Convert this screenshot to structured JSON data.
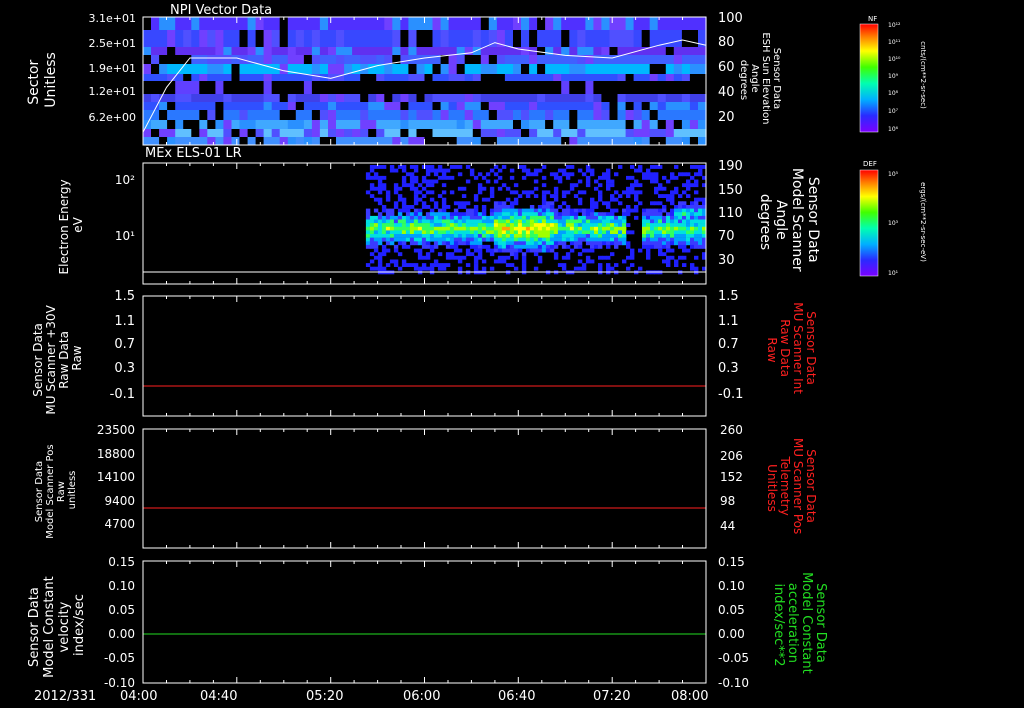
{
  "panels": {
    "p1": {
      "title": "NPI Vector Data",
      "left_label": [
        "Sector",
        "Unitless"
      ],
      "left_ticks": [
        "3.1e+01",
        "2.5e+01",
        "1.9e+01",
        "1.2e+01",
        "6.2e+00"
      ],
      "right_ticks": [
        "100",
        "80",
        "60",
        "40",
        "20"
      ],
      "right_label": [
        "Sensor Data",
        "ESH Sun Elevation",
        "Angle",
        "degrees"
      ],
      "colorbar": {
        "title": "NF",
        "ticks": [
          "10¹²",
          "10¹¹",
          "10¹⁰",
          "10⁹",
          "10⁸",
          "10⁷",
          "10⁶"
        ],
        "units": "cnts/(cm**2-sr-sec)"
      }
    },
    "p2": {
      "title": "MEx ELS-01 LR",
      "left_label": [
        "Electron Energy",
        "eV"
      ],
      "left_ticks": [
        "10²",
        "10¹"
      ],
      "right_ticks": [
        "190",
        "150",
        "110",
        "70",
        "30"
      ],
      "right_label": [
        "Sensor Data",
        "Model Scanner",
        "Angle",
        "degrees"
      ],
      "colorbar": {
        "title": "DEF",
        "ticks": [
          "10⁵",
          "10³",
          "10¹"
        ],
        "units": "ergs/(cm**2-sr-sec-eV)"
      }
    },
    "p3": {
      "left_label": [
        "Sensor Data",
        "MU Scanner +30V",
        "Raw Data",
        "Raw"
      ],
      "left_ticks": [
        "1.5",
        "1.1",
        "0.7",
        "0.3",
        "-0.1"
      ],
      "right_ticks": [
        "1.5",
        "1.1",
        "0.7",
        "0.3",
        "-0.1"
      ],
      "right_label": [
        "Sensor Data",
        "MU Scanner Int",
        "Raw Data",
        "Raw"
      ]
    },
    "p4": {
      "left_label": [
        "Sensor Data",
        "Model Scanner Pos",
        "Raw",
        "unitless"
      ],
      "left_ticks": [
        "23500",
        "18800",
        "14100",
        "9400",
        "4700"
      ],
      "right_ticks": [
        "260",
        "206",
        "152",
        "98",
        "44"
      ],
      "right_label": [
        "Sensor Data",
        "MU Scanner Pos",
        "Telemetry",
        "Unitless"
      ]
    },
    "p5": {
      "left_label": [
        "Sensor Data",
        "Model Constant",
        "velocity",
        "index/sec"
      ],
      "left_ticks": [
        "0.15",
        "0.10",
        "0.05",
        "0.00",
        "-0.05",
        "-0.10"
      ],
      "right_ticks": [
        "0.15",
        "0.10",
        "0.05",
        "0.00",
        "-0.05",
        "-0.10"
      ],
      "right_label": [
        "Sensor Data",
        "Model Constant",
        "acceleration",
        "index/sec**2"
      ]
    }
  },
  "x_axis": {
    "date": "2012/331",
    "ticks": [
      "04:00",
      "04:40",
      "05:20",
      "06:00",
      "06:40",
      "07:20",
      "08:00"
    ]
  },
  "colors": {
    "background": "#000000",
    "axes": "#ffffff",
    "red_trace": "#ff2020",
    "green_trace": "#22dd22",
    "red_label": "#ff2020",
    "green_label": "#22dd22"
  },
  "chart_data": [
    {
      "type": "heatmap",
      "title": "NPI Vector Data",
      "ylabel": "Sector Unitless",
      "y2label": "Sensor Data ESH Sun Elevation Angle degrees",
      "xlim": [
        "04:00",
        "08:00"
      ],
      "ylim": [
        0,
        31
      ],
      "y2lim": [
        0,
        100
      ],
      "overlay_line": {
        "name": "Sensor Data ESH Sun Elevation Angle degrees",
        "x": [
          "04:00",
          "04:10",
          "04:20",
          "04:40",
          "05:00",
          "05:20",
          "05:40",
          "06:00",
          "06:20",
          "06:30",
          "06:40",
          "07:00",
          "07:20",
          "07:40",
          "07:50",
          "08:00"
        ],
        "y": [
          10,
          45,
          68,
          68,
          58,
          52,
          62,
          68,
          72,
          80,
          75,
          70,
          68,
          78,
          82,
          78
        ]
      }
    },
    {
      "type": "heatmap",
      "title": "MEx ELS-01 LR",
      "ylabel": "Electron Energy eV",
      "y2label": "Sensor Data Model Scanner Angle degrees",
      "xlim": [
        "04:00",
        "08:00"
      ],
      "yscale": "log",
      "data_start": "05:35",
      "overlay_line": {
        "name": "Sensor Data Model Scanner Angle degrees",
        "x": [
          "04:00",
          "08:00"
        ],
        "y": [
          10,
          10
        ]
      }
    },
    {
      "type": "line",
      "ylabel": "Sensor Data MU Scanner +30V Raw Data Raw",
      "y2label": "Sensor Data MU Scanner Int Raw Data Raw",
      "ylim": [
        -0.3,
        1.5
      ],
      "series": [
        {
          "name": "Sensor Data MU Scanner +30V Raw Data Raw",
          "x": [
            "04:00",
            "08:00"
          ],
          "y": [
            0.0,
            0.0
          ]
        }
      ]
    },
    {
      "type": "line",
      "ylabel": "Sensor Data Model Scanner Pos Raw unitless",
      "y2label": "Sensor Data MU Scanner Pos Telemetry Unitless",
      "ylim": [
        0,
        23500
      ],
      "series": [
        {
          "name": "Sensor Data Model Scanner Pos Raw unitless",
          "x": [
            "04:00",
            "08:00"
          ],
          "y": [
            8200,
            8200
          ]
        }
      ]
    },
    {
      "type": "line",
      "ylabel": "Sensor Data Model Constant velocity index/sec",
      "y2label": "Sensor Data Model Constant acceleration index/sec**2",
      "ylim": [
        -0.1,
        0.15
      ],
      "series": [
        {
          "name": "Sensor Data Model Constant velocity index/sec",
          "x": [
            "04:00",
            "08:00"
          ],
          "y": [
            0.0,
            0.0
          ]
        }
      ]
    }
  ]
}
